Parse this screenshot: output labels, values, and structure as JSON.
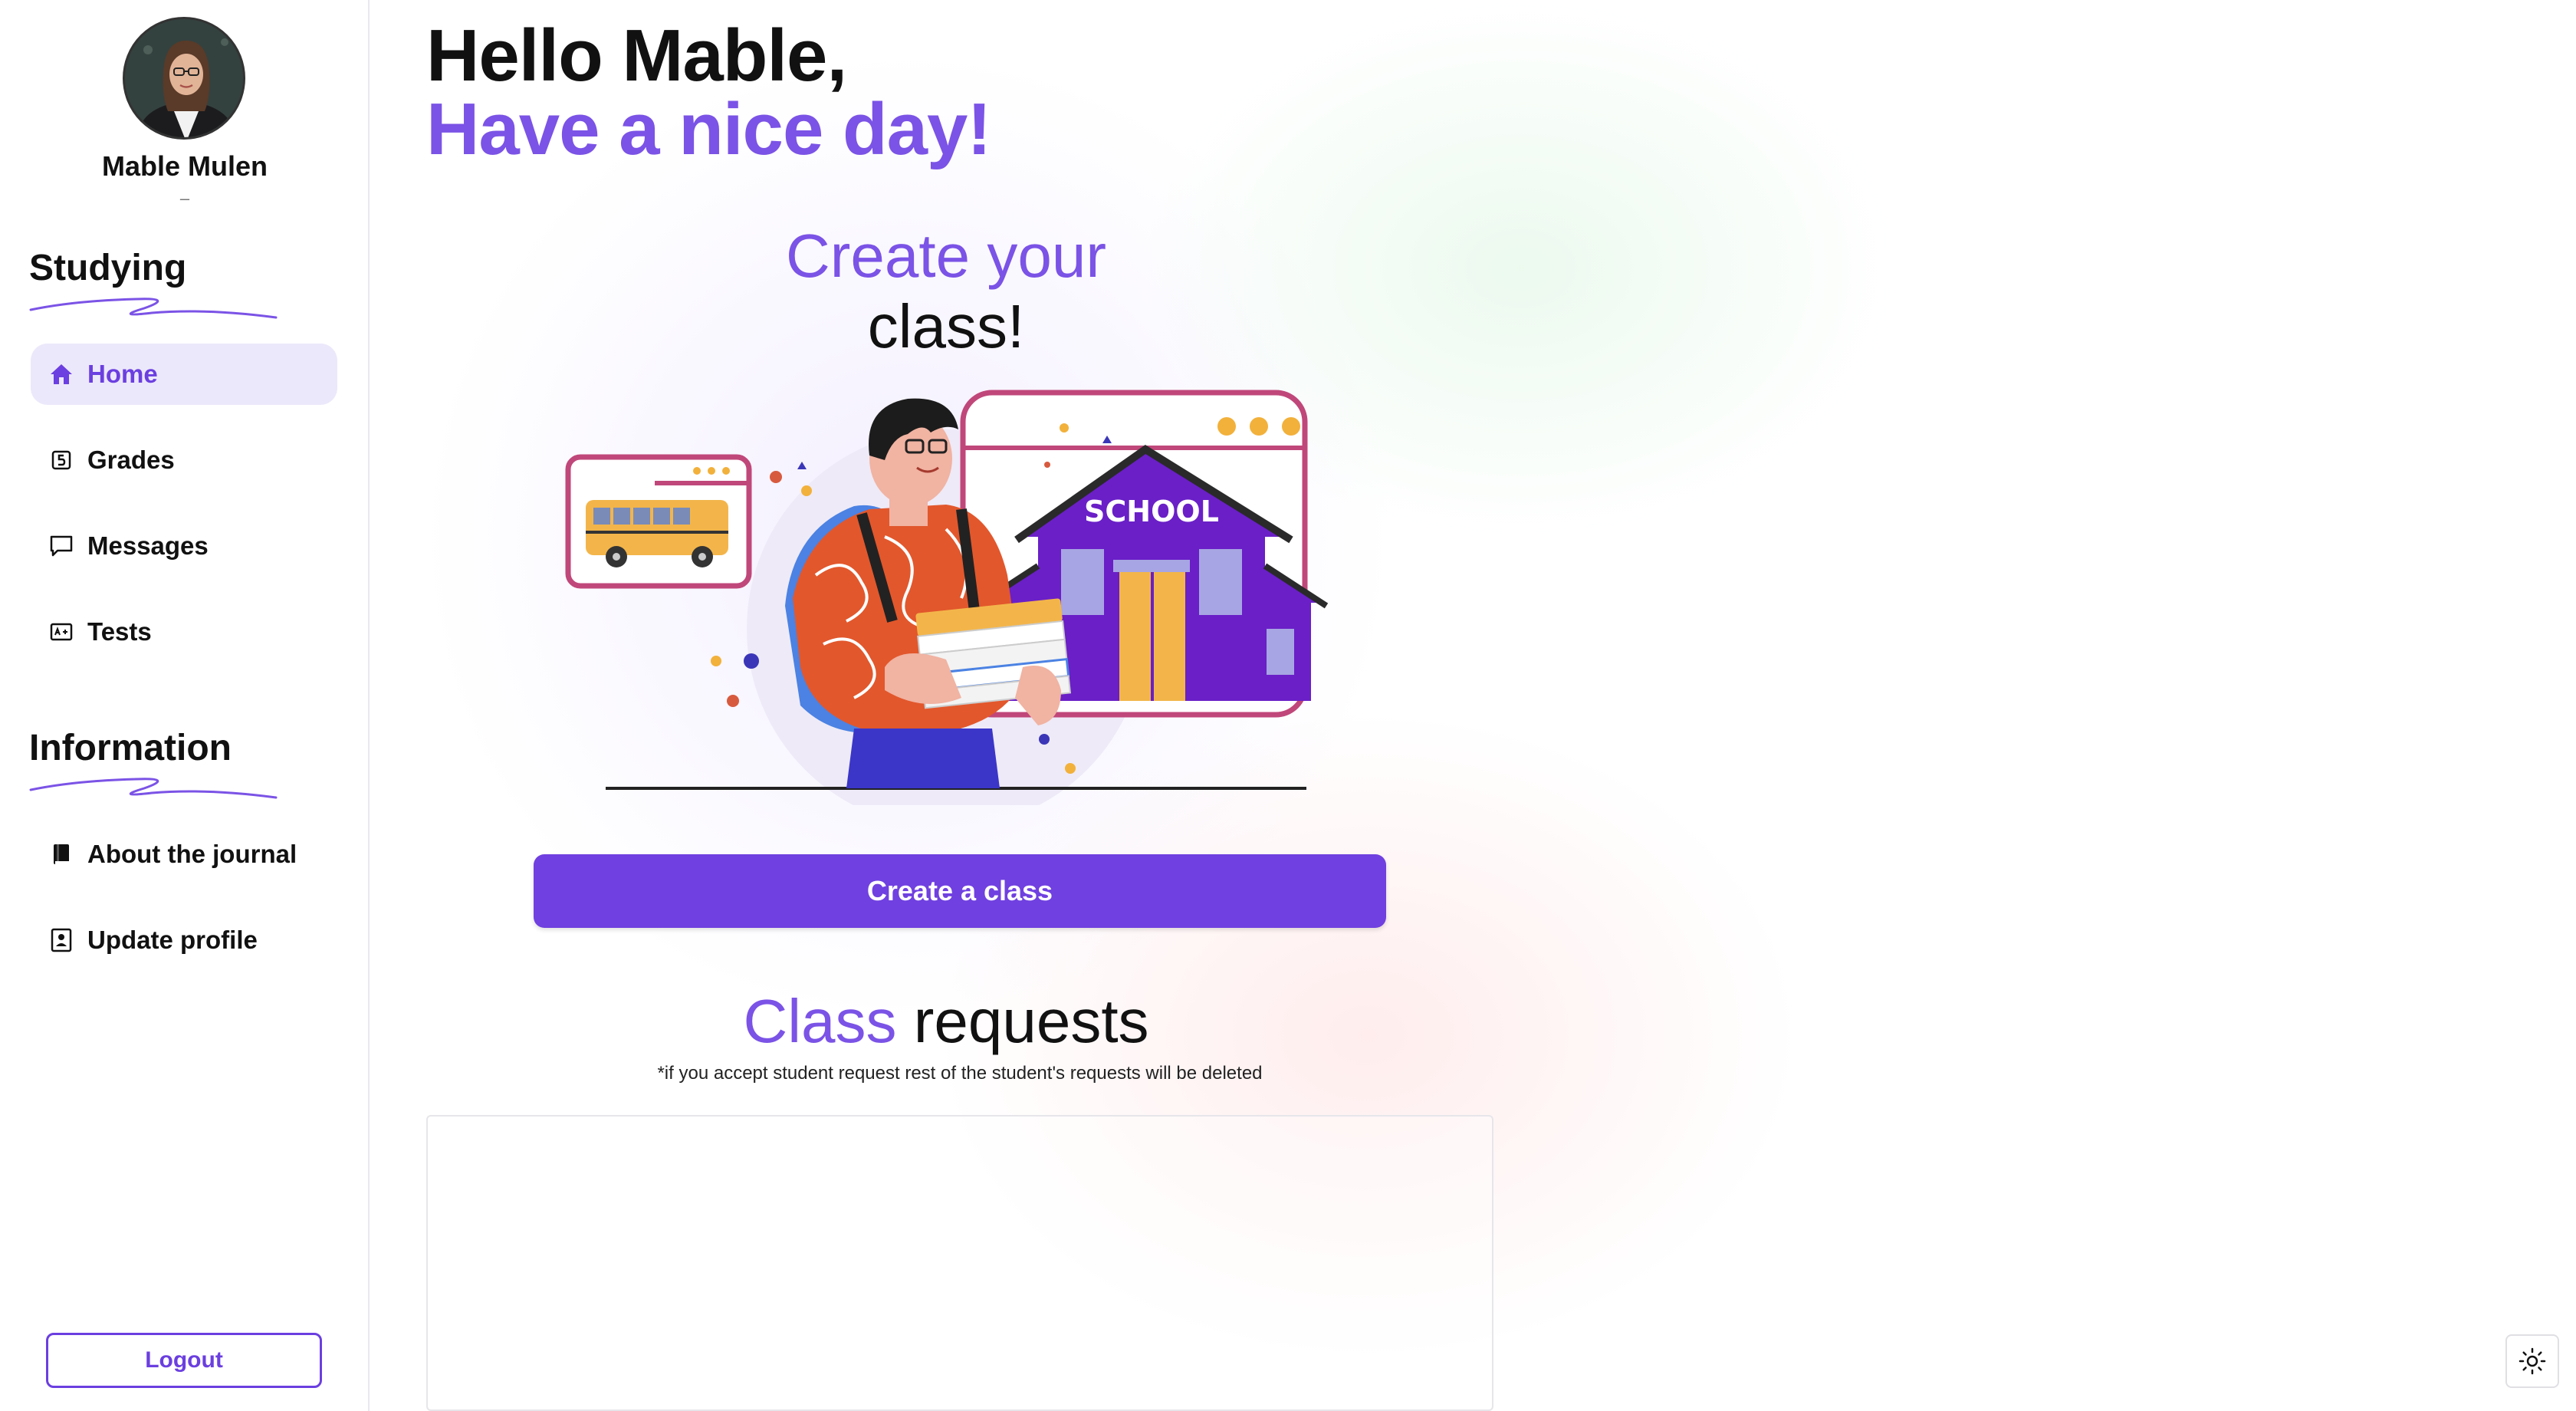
{
  "user": {
    "name": "Mable Mulen",
    "subtitle": "–"
  },
  "sidebar": {
    "studying_title": "Studying",
    "studying_items": [
      {
        "label": "Home",
        "icon": "home-icon",
        "active": true
      },
      {
        "label": "Grades",
        "icon": "grade-icon",
        "active": false
      },
      {
        "label": "Messages",
        "icon": "message-icon",
        "active": false
      },
      {
        "label": "Tests",
        "icon": "test-icon",
        "active": false
      }
    ],
    "information_title": "Information",
    "information_items": [
      {
        "label": "About the journal",
        "icon": "book-icon"
      },
      {
        "label": "Update profile",
        "icon": "profile-icon"
      }
    ],
    "logout_label": "Logout"
  },
  "main": {
    "greeting_line1": "Hello Mable,",
    "greeting_line2": "Have a nice day!",
    "create_title_accent": "Create your",
    "create_title_rest": "class!",
    "illustration_sign": "SCHOOL",
    "create_button_label": "Create a class",
    "requests_title_accent": "Class",
    "requests_title_rest": "requests",
    "requests_note": "*if you accept student request rest of the student's requests will be deleted"
  },
  "colors": {
    "accent": "#7b53e6",
    "button": "#7040e0",
    "active_bg": "#ece8fb"
  },
  "theme_toggle_icon": "sun-icon"
}
